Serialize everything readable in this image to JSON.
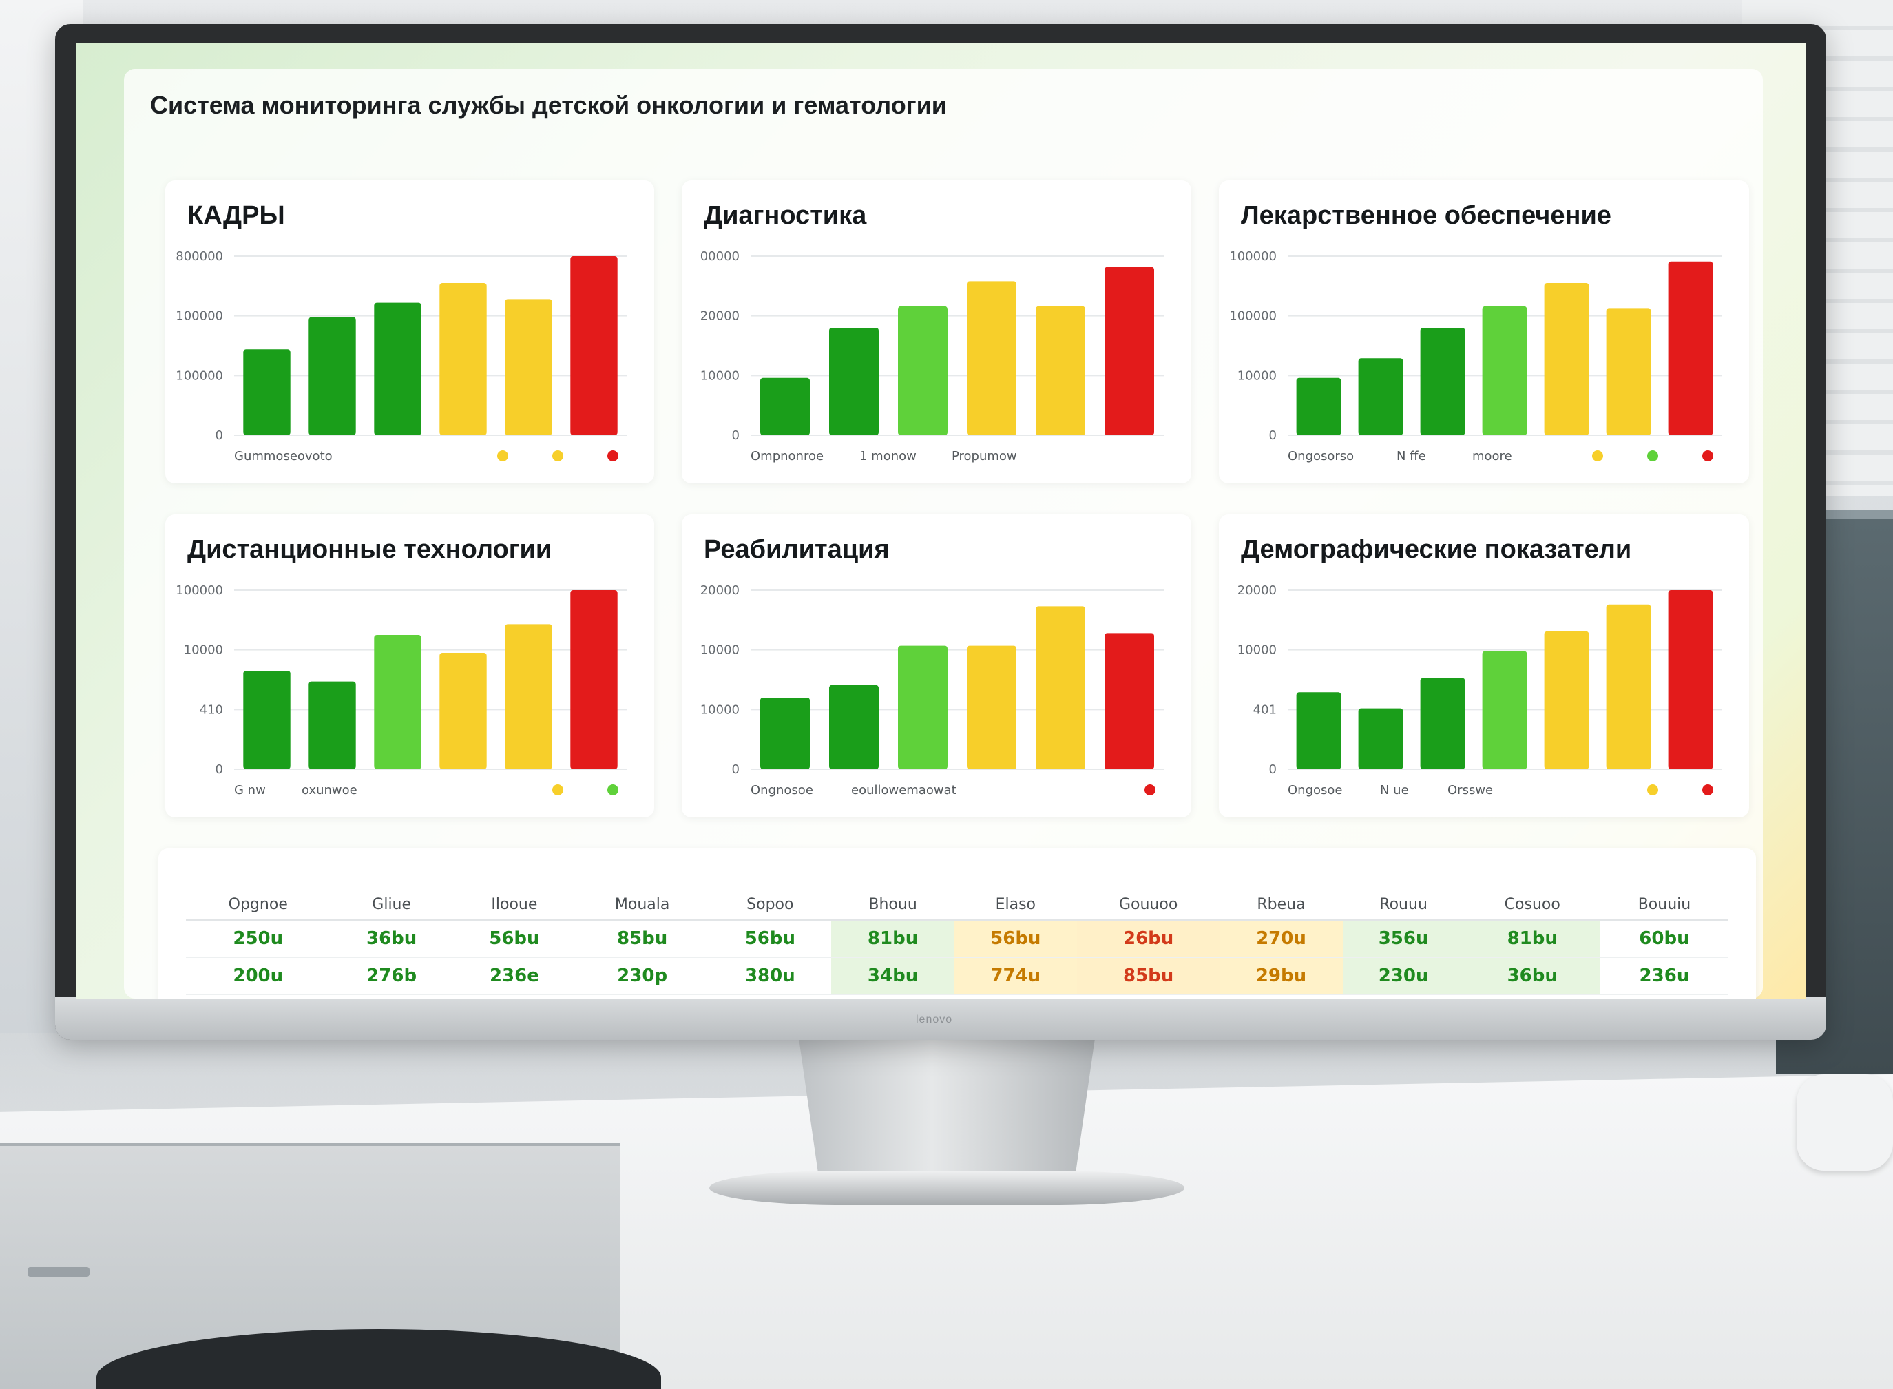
{
  "app_title": "Система мониторинга службы детской онкологии и гематологии",
  "brand": "lenovo",
  "colors": {
    "dark_green": "#1a9e1a",
    "light_green": "#5fd13a",
    "yellow": "#f7cf2a",
    "red": "#e31b1b"
  },
  "chart_data": [
    {
      "type": "bar",
      "title": "КАДРЫ",
      "yticks": [
        "0",
        "100000",
        "100000",
        "800000"
      ],
      "values": [
        48,
        66,
        74,
        85,
        76,
        100
      ],
      "colors": [
        "dark_green",
        "dark_green",
        "dark_green",
        "yellow",
        "yellow",
        "red"
      ],
      "legend": [
        "Gummoseovoto"
      ],
      "legend_dots": [
        "yellow",
        "yellow",
        "red"
      ]
    },
    {
      "type": "bar",
      "title": "Диагностика",
      "yticks": [
        "0",
        "10000",
        "20000",
        "00000"
      ],
      "values": [
        32,
        60,
        72,
        86,
        72,
        94
      ],
      "colors": [
        "dark_green",
        "dark_green",
        "light_green",
        "yellow",
        "yellow",
        "red"
      ],
      "legend": [
        "Ompnonroe",
        "1 monow",
        "Propumow"
      ],
      "legend_dots": []
    },
    {
      "type": "bar",
      "title": "Лекарственное обеспечение",
      "yticks": [
        "0",
        "10000",
        "100000",
        "100000"
      ],
      "values": [
        32,
        43,
        60,
        72,
        85,
        71,
        97
      ],
      "colors": [
        "dark_green",
        "dark_green",
        "dark_green",
        "light_green",
        "yellow",
        "yellow",
        "red"
      ],
      "legend": [
        "Ongosorso",
        "N ffe",
        "moore"
      ],
      "legend_dots": [
        "yellow",
        "light_green",
        "red"
      ]
    },
    {
      "type": "bar",
      "title": "Дистанционные технологии",
      "yticks": [
        "0",
        "410",
        "10000",
        "100000"
      ],
      "values": [
        55,
        49,
        75,
        65,
        81,
        100
      ],
      "colors": [
        "dark_green",
        "dark_green",
        "light_green",
        "yellow",
        "yellow",
        "red"
      ],
      "legend": [
        "G nw",
        "oxunwoe"
      ],
      "legend_dots": [
        "yellow",
        "light_green"
      ]
    },
    {
      "type": "bar",
      "title": "Реабилитация",
      "yticks": [
        "0",
        "10000",
        "10000",
        "20000"
      ],
      "values": [
        40,
        47,
        69,
        69,
        91,
        76
      ],
      "colors": [
        "dark_green",
        "dark_green",
        "light_green",
        "yellow",
        "yellow",
        "red"
      ],
      "legend": [
        "Ongnosoe",
        "eoullowemaowat"
      ],
      "legend_dots": [
        "red"
      ]
    },
    {
      "type": "bar",
      "title": "Демографические показатели",
      "yticks": [
        "0",
        "401",
        "10000",
        "20000"
      ],
      "values": [
        43,
        34,
        51,
        66,
        77,
        92,
        100
      ],
      "colors": [
        "dark_green",
        "dark_green",
        "dark_green",
        "light_green",
        "yellow",
        "yellow",
        "red"
      ],
      "legend": [
        "Ongosoe",
        "N ue",
        "Orsswe"
      ],
      "legend_dots": [
        "yellow",
        "red"
      ]
    }
  ],
  "table": {
    "headers": [
      "Opgnoe",
      "Gliue",
      "Ilooue",
      "Mouala",
      "Sopoo",
      "Bhouu",
      "Elaso",
      "Gouuoo",
      "Rbeua",
      "Rouuu",
      "Cosuoo",
      "Bouuiu"
    ],
    "rows": [
      [
        "250u",
        "36bu",
        "56bu",
        "85bu",
        "56bu",
        "81bu",
        "56bu",
        "26bu",
        "270u",
        "356u",
        "81bu",
        "60bu"
      ],
      [
        "200u",
        "276b",
        "236e",
        "230p",
        "380u",
        "34bu",
        "774u",
        "85bu",
        "29bu",
        "230u",
        "36bu",
        "236u"
      ]
    ],
    "cell_colors": [
      "",
      "",
      "",
      "",
      "",
      "c-green",
      "c-yellow",
      "c-red",
      "c-yellow",
      "c-green",
      "c-green",
      ""
    ]
  }
}
